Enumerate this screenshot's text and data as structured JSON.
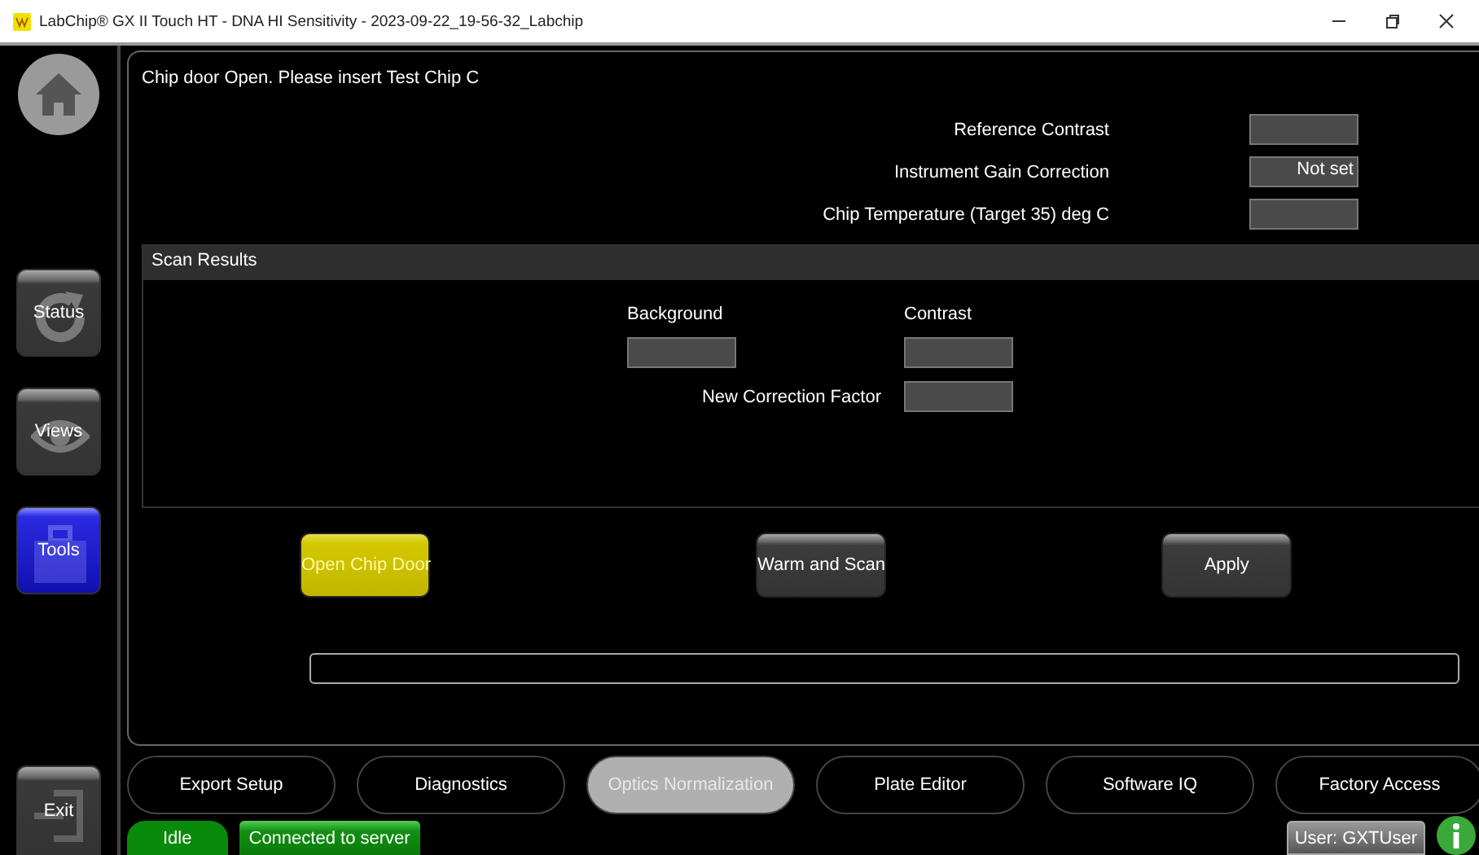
{
  "window": {
    "title": "LabChip® GX II Touch HT - DNA HI Sensitivity - 2023-09-22_19-56-32_Labchip"
  },
  "nav": [
    {
      "kind": "home",
      "selected": false
    },
    {
      "kind": "status",
      "label": "Status",
      "selected": false
    },
    {
      "kind": "views",
      "label": "Views",
      "selected": false
    },
    {
      "kind": "tools",
      "label": "Tools",
      "selected": true
    }
  ],
  "exit": {
    "label": "Exit"
  },
  "message": "Chip door Open. Please insert Test Chip C",
  "readings": [
    {
      "label": "Reference Contrast"
    },
    {
      "label": "Instrument Gain Correction",
      "value": "Not set"
    },
    {
      "label": "Chip Temperature (Target 35) deg C"
    }
  ],
  "scan_results": {
    "title": "Scan Results",
    "headings": [
      "Background",
      "Contrast"
    ],
    "correction_label": "New Correction Factor"
  },
  "actions": [
    {
      "label": "Open Chip Door",
      "highlighted": true
    },
    {
      "label": "Warm and Scan",
      "highlighted": false
    },
    {
      "label": "Apply",
      "highlighted": false
    }
  ],
  "progress": {
    "level": 0
  },
  "tabs": [
    {
      "label": "Export Setup",
      "selected": false
    },
    {
      "label": "Diagnostics",
      "selected": false
    },
    {
      "label": "Optics Normalization",
      "selected": true
    },
    {
      "label": "Plate Editor",
      "selected": false
    },
    {
      "label": "Software IQ",
      "selected": false
    },
    {
      "label": "Factory Access",
      "selected": false
    }
  ],
  "status_bar": {
    "state": "Idle",
    "connection": "Connected to server",
    "user": "User: GXTUser"
  }
}
